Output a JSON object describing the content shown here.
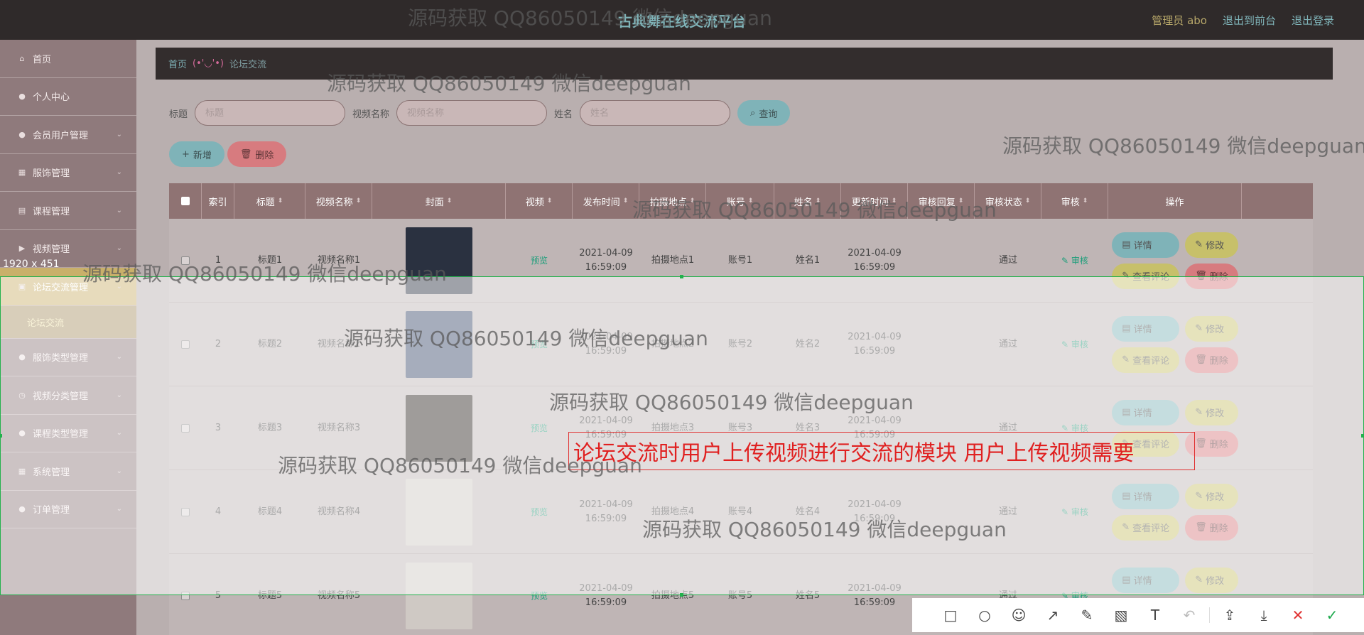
{
  "header": {
    "title": "古典舞在线交流平台",
    "admin_label": "管理员 abo",
    "to_front": "退出到前台",
    "logout": "退出登录"
  },
  "sidebar": {
    "items": [
      {
        "label": "首页",
        "icon": "home-icon"
      },
      {
        "label": "个人中心",
        "icon": "user-icon"
      },
      {
        "label": "会员用户管理",
        "icon": "user-icon"
      },
      {
        "label": "服饰管理",
        "icon": "grid-icon"
      },
      {
        "label": "课程管理",
        "icon": "book-icon"
      },
      {
        "label": "视频管理",
        "icon": "video-icon"
      },
      {
        "label": "论坛交流管理",
        "icon": "clipboard-icon"
      },
      {
        "label": "服饰类型管理",
        "icon": "user-icon"
      },
      {
        "label": "视频分类管理",
        "icon": "clock-icon"
      },
      {
        "label": "课程类型管理",
        "icon": "user-icon"
      },
      {
        "label": "系统管理",
        "icon": "grid-icon"
      },
      {
        "label": "订单管理",
        "icon": "user-icon"
      }
    ],
    "sub_item": "论坛交流"
  },
  "breadcrumb": {
    "home": "首页",
    "face": "(•'◡'•)",
    "current": "论坛交流"
  },
  "filters": {
    "title_label": "标题",
    "title_placeholder": "标题",
    "video_label": "视频名称",
    "video_placeholder": "视频名称",
    "name_label": "姓名",
    "name_placeholder": "姓名",
    "query": "查询"
  },
  "actions": {
    "add": "新增",
    "delete": "删除"
  },
  "table": {
    "headers": [
      "索引",
      "标题",
      "视频名称",
      "封面",
      "视频",
      "发布时间",
      "拍摄地点",
      "账号",
      "姓名",
      "更新时间",
      "审核回复",
      "审核状态",
      "审核",
      "操作"
    ],
    "rows": [
      {
        "idx": "1",
        "title": "标题1",
        "video": "视频名称1",
        "preview": "预览",
        "pub": "2021-04-09\n16:59:09",
        "place": "拍摄地点1",
        "acct": "账号1",
        "name": "姓名1",
        "upd": "2021-04-09\n16:59:09",
        "reply": "",
        "status": "通过",
        "audit": "审核",
        "cover": "#2a3140"
      },
      {
        "idx": "2",
        "title": "标题2",
        "video": "视频名称2",
        "preview": "预览",
        "pub": "2021-04-09\n16:59:09",
        "place": "拍摄地点2",
        "acct": "账号2",
        "name": "姓名2",
        "upd": "2021-04-09\n16:59:09",
        "reply": "",
        "status": "通过",
        "audit": "审核",
        "cover": "#3a4a6a"
      },
      {
        "idx": "3",
        "title": "标题3",
        "video": "视频名称3",
        "preview": "预览",
        "pub": "2021-04-09\n16:59:09",
        "place": "拍摄地点3",
        "acct": "账号3",
        "name": "姓名3",
        "upd": "2021-04-09\n16:59:09",
        "reply": "",
        "status": "通过",
        "audit": "审核",
        "cover": "#2b2420"
      },
      {
        "idx": "4",
        "title": "标题4",
        "video": "视频名称4",
        "preview": "预览",
        "pub": "2021-04-09\n16:59:09",
        "place": "拍摄地点4",
        "acct": "账号4",
        "name": "姓名4",
        "upd": "2021-04-09\n16:59:09",
        "reply": "",
        "status": "通过",
        "audit": "审核",
        "cover": "#cfc9c4"
      },
      {
        "idx": "5",
        "title": "标题5",
        "video": "视频名称5",
        "preview": "预览",
        "pub": "2021-04-09\n16:59:09",
        "place": "拍摄地点5",
        "acct": "账号5",
        "name": "姓名5",
        "upd": "2021-04-09\n16:59:09",
        "reply": "",
        "status": "通过",
        "audit": "审核",
        "cover": "#cfc9c4"
      }
    ],
    "ops": {
      "detail": "详情",
      "edit": "修改",
      "comment": "查看评论",
      "remove": "删除"
    }
  },
  "overlay": {
    "size_label": "1920 x 451",
    "annotation": "论坛交流时用户上传视频进行交流的模块 用户上传视频需要",
    "watermark": "源码获取 QQ86050149 微信deepguan"
  },
  "toolbar": [
    "rect-icon",
    "circle-icon",
    "emoji-icon",
    "arrow-icon",
    "pen-icon",
    "mosaic-icon",
    "text-icon",
    "undo-icon",
    "share-icon",
    "download-icon",
    "close-icon",
    "confirm-icon"
  ]
}
